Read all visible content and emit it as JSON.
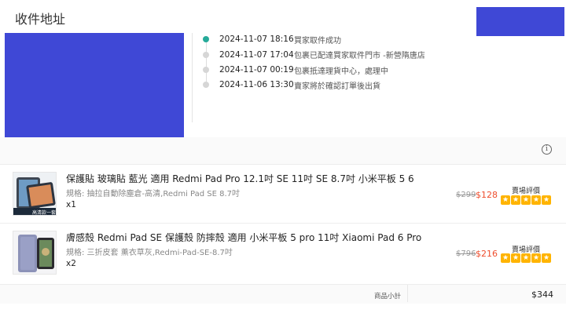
{
  "page": {
    "title": "收件地址"
  },
  "tracking": [
    {
      "time": "2024-11-07 18:16",
      "desc": "買家取件成功",
      "active": true
    },
    {
      "time": "2024-11-07 17:04",
      "desc": "包裹已配達買家取件門市 -新營隋唐店",
      "active": false
    },
    {
      "time": "2024-11-07 00:19",
      "desc": "包裹抵達理貨中心，處理中",
      "active": false
    },
    {
      "time": "2024-11-06 13:30",
      "desc": "賣家將於確認訂單後出貨",
      "active": false
    }
  ],
  "info_icon_glyph": "i",
  "products": [
    {
      "name": "保護貼 玻璃貼 藍光 適用 Redmi Pad Pro 12.1吋 SE 11吋 SE 8.7吋 小米平板 5 6",
      "variant": "規格: 抽拉自動除塵倉-高清,Redmi Pad SE 8.7吋",
      "qty": "x1",
      "old_price": "$299",
      "price": "$128",
      "rating_label": "賣場評價",
      "stars": 5,
      "thumb_caption": "高清款一套裝"
    },
    {
      "name": "膚感殼 Redmi Pad SE 保護殼 防摔殼 適用 小米平板 5 pro 11吋 Xiaomi Pad 6 Pro",
      "variant": "規格: 三折皮套 薰衣草灰,Redmi-Pad-SE-8.7吋",
      "qty": "x2",
      "old_price": "$796",
      "price": "$216",
      "rating_label": "賣場評價",
      "stars": 5
    }
  ],
  "summary": {
    "label": "商品小計",
    "value": "$344"
  },
  "colors": {
    "accent": "#ee4d2d",
    "active_dot": "#26aa99",
    "redaction": "#3f48d6",
    "star": "#ffb400"
  }
}
